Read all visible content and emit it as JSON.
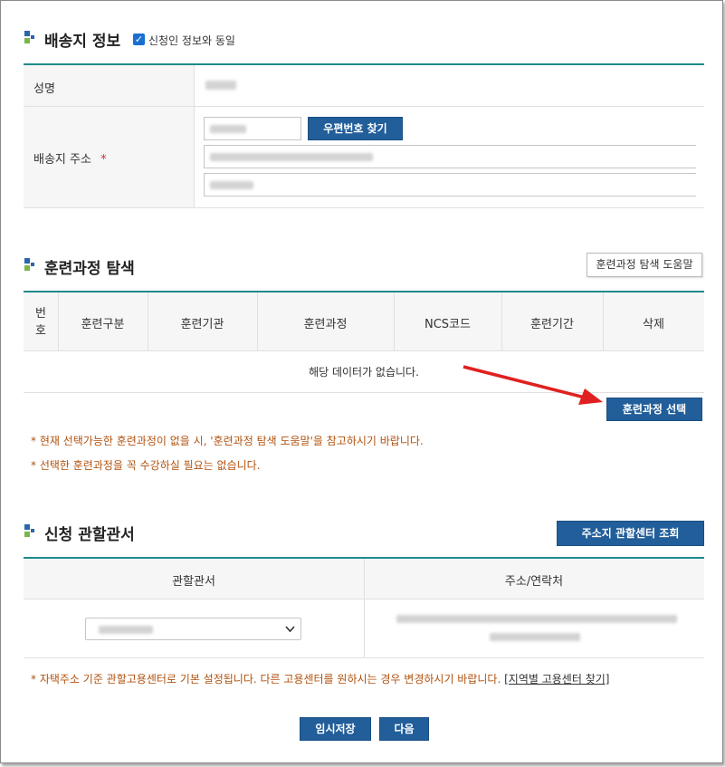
{
  "shipping": {
    "title": "배송지 정보",
    "same_as_applicant_label": "신청인 정보와 동일",
    "same_as_applicant_checked": true,
    "name_label": "성명",
    "address_label": "배송지 주소",
    "required_mark": "*",
    "zip_search_button": "우편번호 찾기"
  },
  "course_search": {
    "title": "훈련과정 탐색",
    "help_button": "훈련과정 탐색 도움말",
    "columns": [
      "번호",
      "훈련구분",
      "훈련기관",
      "훈련과정",
      "NCS코드",
      "훈련기간",
      "삭제"
    ],
    "no_data": "해당 데이터가 없습니다.",
    "select_button": "훈련과정 선택",
    "notes": [
      "* 현재 선택가능한 훈련과정이 없을 시, '훈련과정 탐색 도움말'을 참고하시기 바랍니다.",
      "* 선택한 훈련과정을 꼭 수강하실 필요는 없습니다."
    ]
  },
  "office": {
    "title": "신청 관할관서",
    "lookup_button": "주소지 관할센터 조회",
    "col_office": "관할관서",
    "col_address": "주소/연락처",
    "note": "* 자택주소 기준 관할고용센터로 기본 설정됩니다. 다른 고용센터를 원하시는 경우 변경하시기 바랍니다.",
    "note_link": "[지역별 고용센터 찾기]"
  },
  "footer": {
    "temp_save_button": "임시저장",
    "next_button": "다음"
  },
  "colors": {
    "primary_button": "#215e9a",
    "table_top_line": "#1f8a8a",
    "note_text": "#b0520f",
    "annotation_arrow": "#e02020"
  },
  "icons": {
    "section_bullet": "section-bullet-icon",
    "dropdown": "chevron-down-icon",
    "arrow": "red-arrow-annotation"
  }
}
